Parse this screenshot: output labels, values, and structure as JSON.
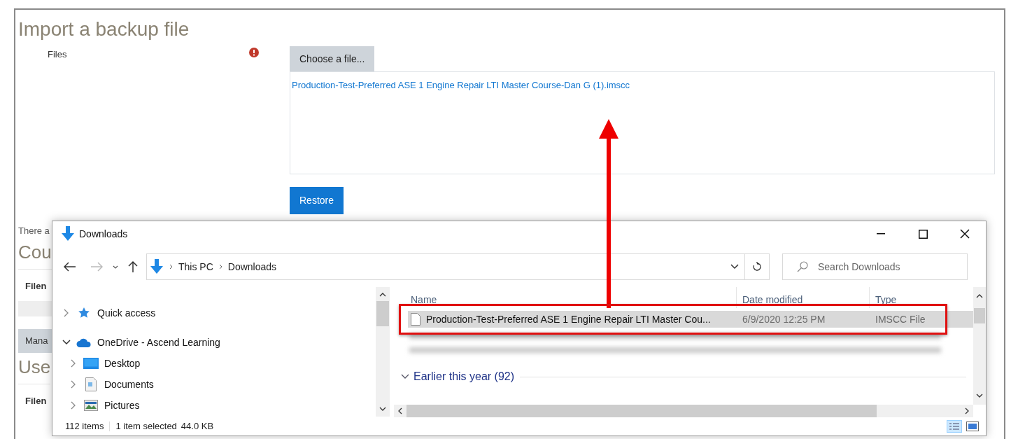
{
  "page": {
    "title": "Import a backup file",
    "files_label": "Files",
    "required": true,
    "choose_button": "Choose a file...",
    "file_link": "Production-Test-Preferred ASE 1 Engine Repair LTI Master Course-Dan G (1).imscc",
    "restore_button": "Restore",
    "behind": [
      {
        "kind": "note",
        "text": "There a"
      },
      {
        "kind": "heading",
        "text": "Cou"
      },
      {
        "kind": "column",
        "text": "Filen"
      },
      {
        "kind": "bar"
      },
      {
        "kind": "button",
        "text": "Mana"
      },
      {
        "kind": "heading",
        "text": "Use"
      },
      {
        "kind": "column",
        "text": "Filen"
      }
    ]
  },
  "explorer": {
    "title": "Downloads",
    "path": [
      "This PC",
      "Downloads"
    ],
    "search": {
      "placeholder": "Search Downloads"
    },
    "tree": [
      {
        "label": "Quick access",
        "kind": "star",
        "expanded": false
      },
      {
        "label": "OneDrive - Ascend Learning",
        "kind": "cloud",
        "expanded": true,
        "children": [
          {
            "label": "Desktop",
            "kind": "desktop",
            "expanded": false
          },
          {
            "label": "Documents",
            "kind": "documents",
            "expanded": false
          },
          {
            "label": "Pictures",
            "kind": "pictures",
            "expanded": false
          }
        ]
      }
    ],
    "columns": [
      "Name",
      "Date modified",
      "Type"
    ],
    "rows": [
      {
        "name": "Production-Test-Preferred ASE 1 Engine Repair LTI Master Cou...",
        "date": "6/9/2020 12:25 PM",
        "type": "IMSCC File",
        "selected": true
      }
    ],
    "group": "Earlier this year (92)",
    "status": {
      "items": "112 items",
      "selected": "1 item selected",
      "size": "44.0 KB"
    }
  }
}
